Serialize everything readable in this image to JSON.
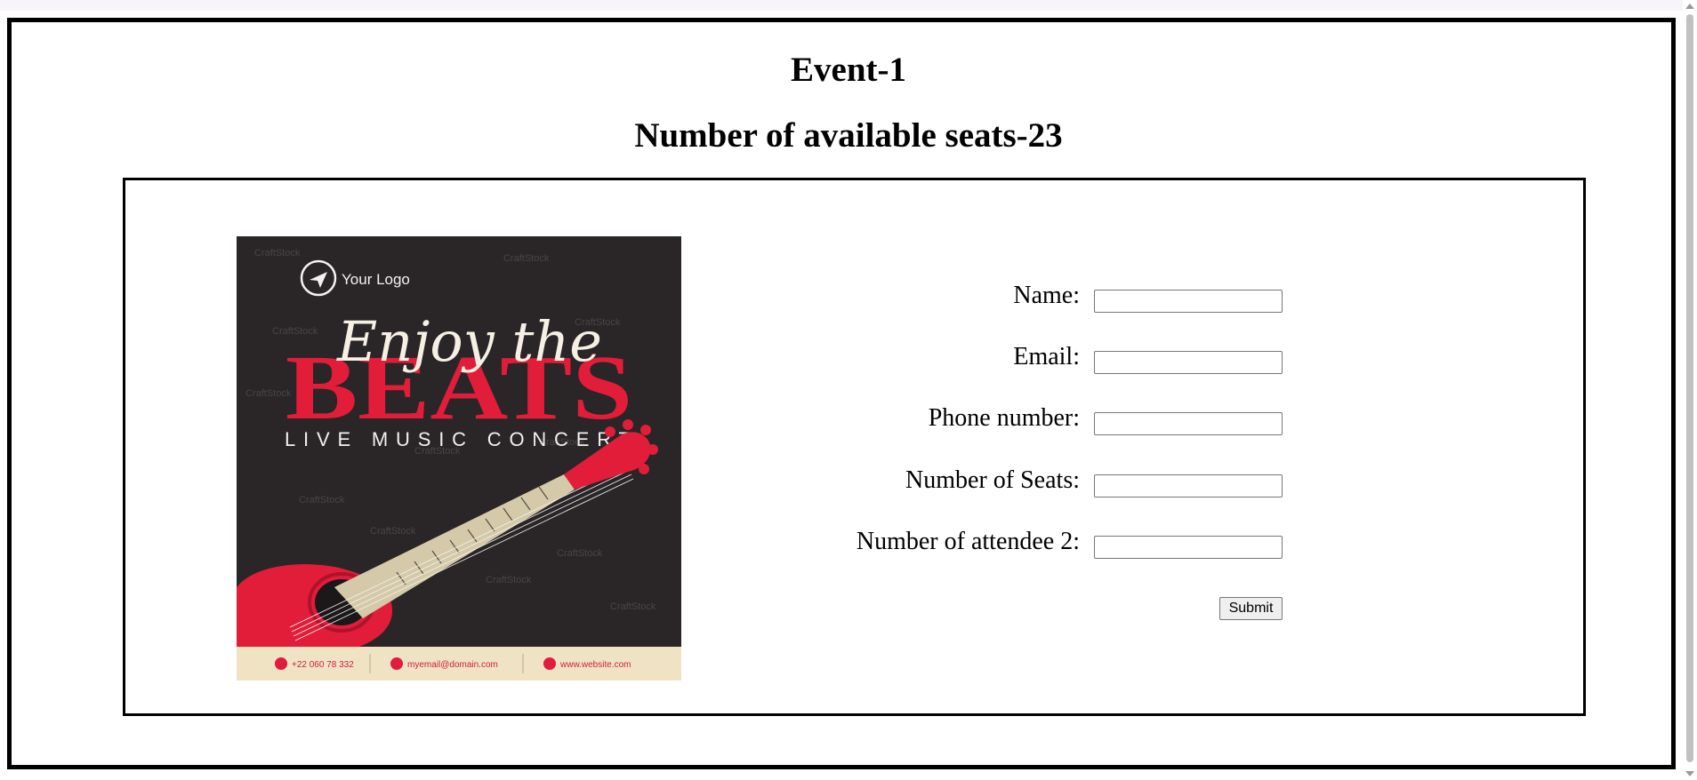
{
  "event": {
    "title": "Event-1",
    "seats_heading": "Number of available seats-23"
  },
  "poster": {
    "logo_text": "Your Logo",
    "script_text": "Enjoy the",
    "headline": "BEATS",
    "subheadline": "LIVE MUSIC CONCERT",
    "contact_phone": "+22 060 78 332",
    "contact_email": "myemail@domain.com",
    "contact_web": "www.website.com",
    "watermark": "CraftStock",
    "colors": {
      "background": "#2a2526",
      "accent": "#e11d3a",
      "footer": "#efe3c4"
    }
  },
  "form": {
    "fields": [
      {
        "label": "Name:",
        "value": "",
        "placeholder": ""
      },
      {
        "label": "Email:",
        "value": "",
        "placeholder": ""
      },
      {
        "label": "Phone number:",
        "value": "",
        "placeholder": ""
      },
      {
        "label": "Number of Seats:",
        "value": "",
        "placeholder": ""
      },
      {
        "label": "Number of attendee 2:",
        "value": "",
        "placeholder": ""
      }
    ],
    "submit_label": "Submit"
  }
}
